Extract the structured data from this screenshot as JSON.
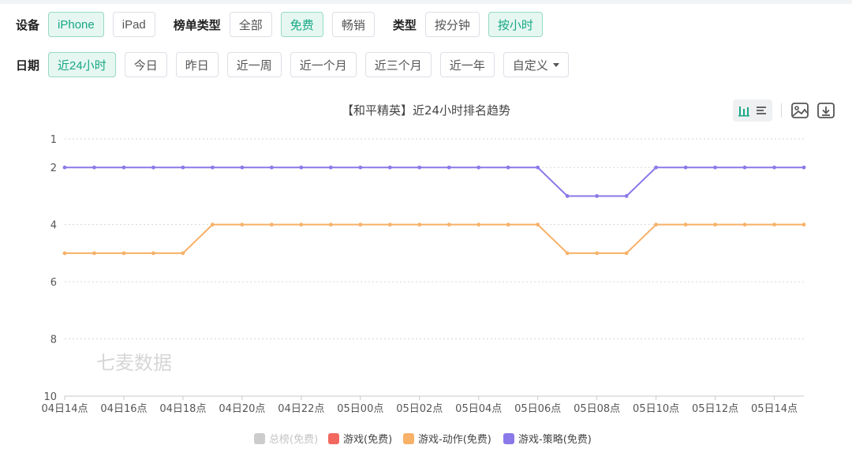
{
  "filters": {
    "device": {
      "label": "设备",
      "options": [
        "iPhone",
        "iPad"
      ],
      "active": 0
    },
    "rank_type": {
      "label": "榜单类型",
      "options": [
        "全部",
        "免费",
        "畅销"
      ],
      "active": 1
    },
    "type": {
      "label": "类型",
      "options": [
        "按分钟",
        "按小时"
      ],
      "active": 1
    },
    "date": {
      "label": "日期",
      "options": [
        "近24小时",
        "今日",
        "昨日",
        "近一周",
        "近一个月",
        "近三个月",
        "近一年",
        "自定义"
      ],
      "active": 0
    }
  },
  "toolbar": {
    "icons": [
      "bar-chart-icon",
      "list-icon",
      "image-icon",
      "download-icon"
    ]
  },
  "watermark": "七麦数据",
  "colors": {
    "accent": "#17a884",
    "strategy": "#8a79e8",
    "action": "#f7b168",
    "game": "#f2685f",
    "overall": "#cccccc"
  },
  "chart_data": {
    "type": "line",
    "title": "【和平精英】近24小时排名趋势",
    "y_axis": {
      "ticks": [
        1,
        2,
        4,
        6,
        8,
        10
      ],
      "range": [
        1,
        10
      ],
      "inverted": true
    },
    "x_tick_labels": [
      "04日14点",
      "04日16点",
      "04日18点",
      "04日20点",
      "04日22点",
      "05日00点",
      "05日02点",
      "05日04点",
      "05日06点",
      "05日08点",
      "05日10点",
      "05日12点",
      "05日14点"
    ],
    "x_range_hours": [
      0,
      25
    ],
    "grid": true,
    "legend_position": "bottom",
    "series": [
      {
        "name": "总榜(免费)",
        "color": "#cccccc",
        "disabled": true,
        "points": []
      },
      {
        "name": "游戏(免费)",
        "color": "#f2685f",
        "disabled": false,
        "points": []
      },
      {
        "name": "游戏-动作(免费)",
        "color": "#f7b168",
        "disabled": false,
        "points": [
          [
            0,
            5
          ],
          [
            1,
            5
          ],
          [
            2,
            5
          ],
          [
            3,
            5
          ],
          [
            4,
            5
          ],
          [
            5,
            4
          ],
          [
            6,
            4
          ],
          [
            7,
            4
          ],
          [
            8,
            4
          ],
          [
            9,
            4
          ],
          [
            10,
            4
          ],
          [
            11,
            4
          ],
          [
            12,
            4
          ],
          [
            13,
            4
          ],
          [
            14,
            4
          ],
          [
            15,
            4
          ],
          [
            16,
            4
          ],
          [
            17,
            5
          ],
          [
            18,
            5
          ],
          [
            19,
            5
          ],
          [
            20,
            4
          ],
          [
            21,
            4
          ],
          [
            22,
            4
          ],
          [
            23,
            4
          ],
          [
            24,
            4
          ],
          [
            25,
            4
          ]
        ]
      },
      {
        "name": "游戏-策略(免费)",
        "color": "#8a79e8",
        "disabled": false,
        "points": [
          [
            0,
            2
          ],
          [
            1,
            2
          ],
          [
            2,
            2
          ],
          [
            3,
            2
          ],
          [
            4,
            2
          ],
          [
            5,
            2
          ],
          [
            6,
            2
          ],
          [
            7,
            2
          ],
          [
            8,
            2
          ],
          [
            9,
            2
          ],
          [
            10,
            2
          ],
          [
            11,
            2
          ],
          [
            12,
            2
          ],
          [
            13,
            2
          ],
          [
            14,
            2
          ],
          [
            15,
            2
          ],
          [
            16,
            2
          ],
          [
            17,
            3
          ],
          [
            18,
            3
          ],
          [
            19,
            3
          ],
          [
            20,
            2
          ],
          [
            21,
            2
          ],
          [
            22,
            2
          ],
          [
            23,
            2
          ],
          [
            24,
            2
          ],
          [
            25,
            2
          ]
        ]
      }
    ]
  }
}
